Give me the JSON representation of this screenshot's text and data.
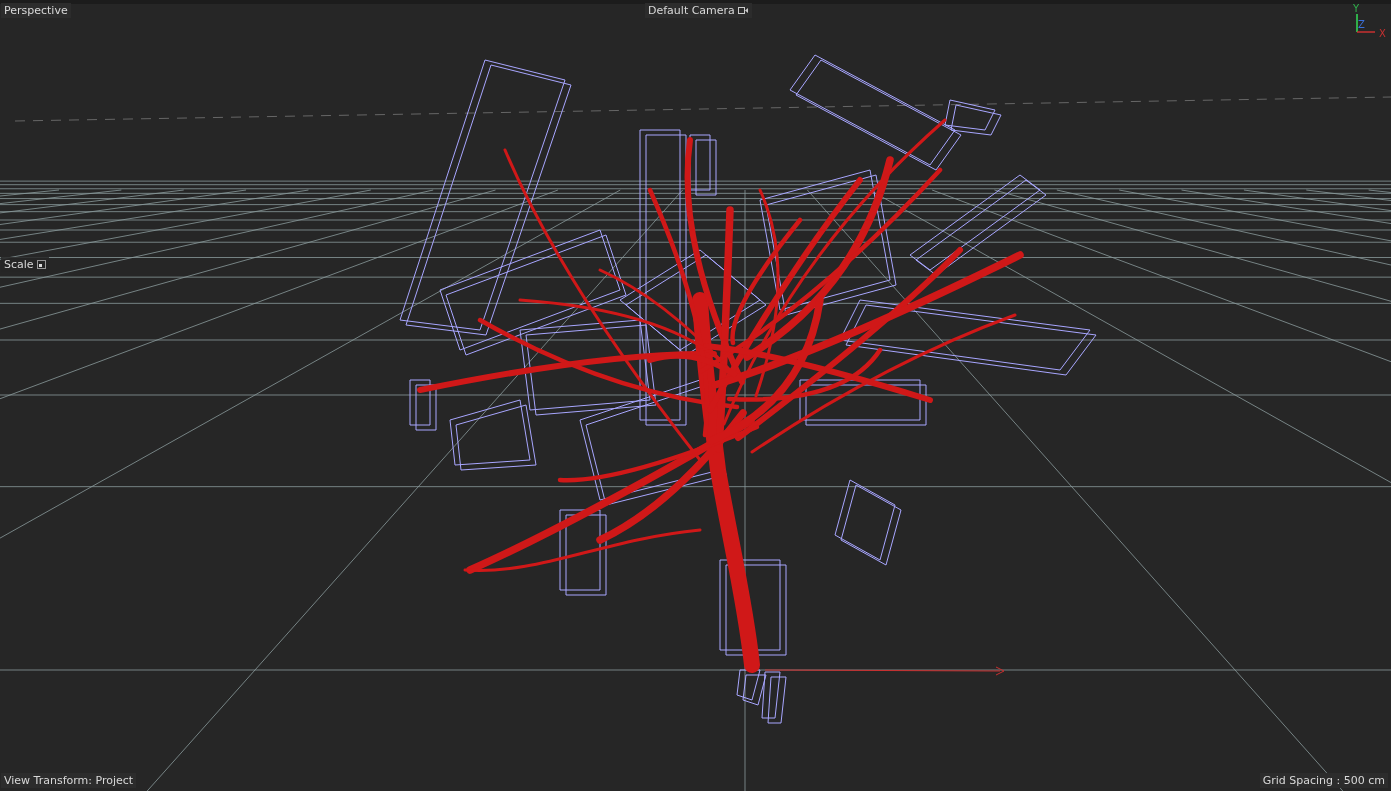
{
  "viewport": {
    "view_name": "Perspective",
    "camera": "Default Camera",
    "scale_label": "Scale",
    "view_transform": "View Transform: Project",
    "grid_spacing": "Grid Spacing : 500 cm",
    "axes": {
      "y": "Y",
      "z": "Z",
      "x": "X"
    }
  }
}
